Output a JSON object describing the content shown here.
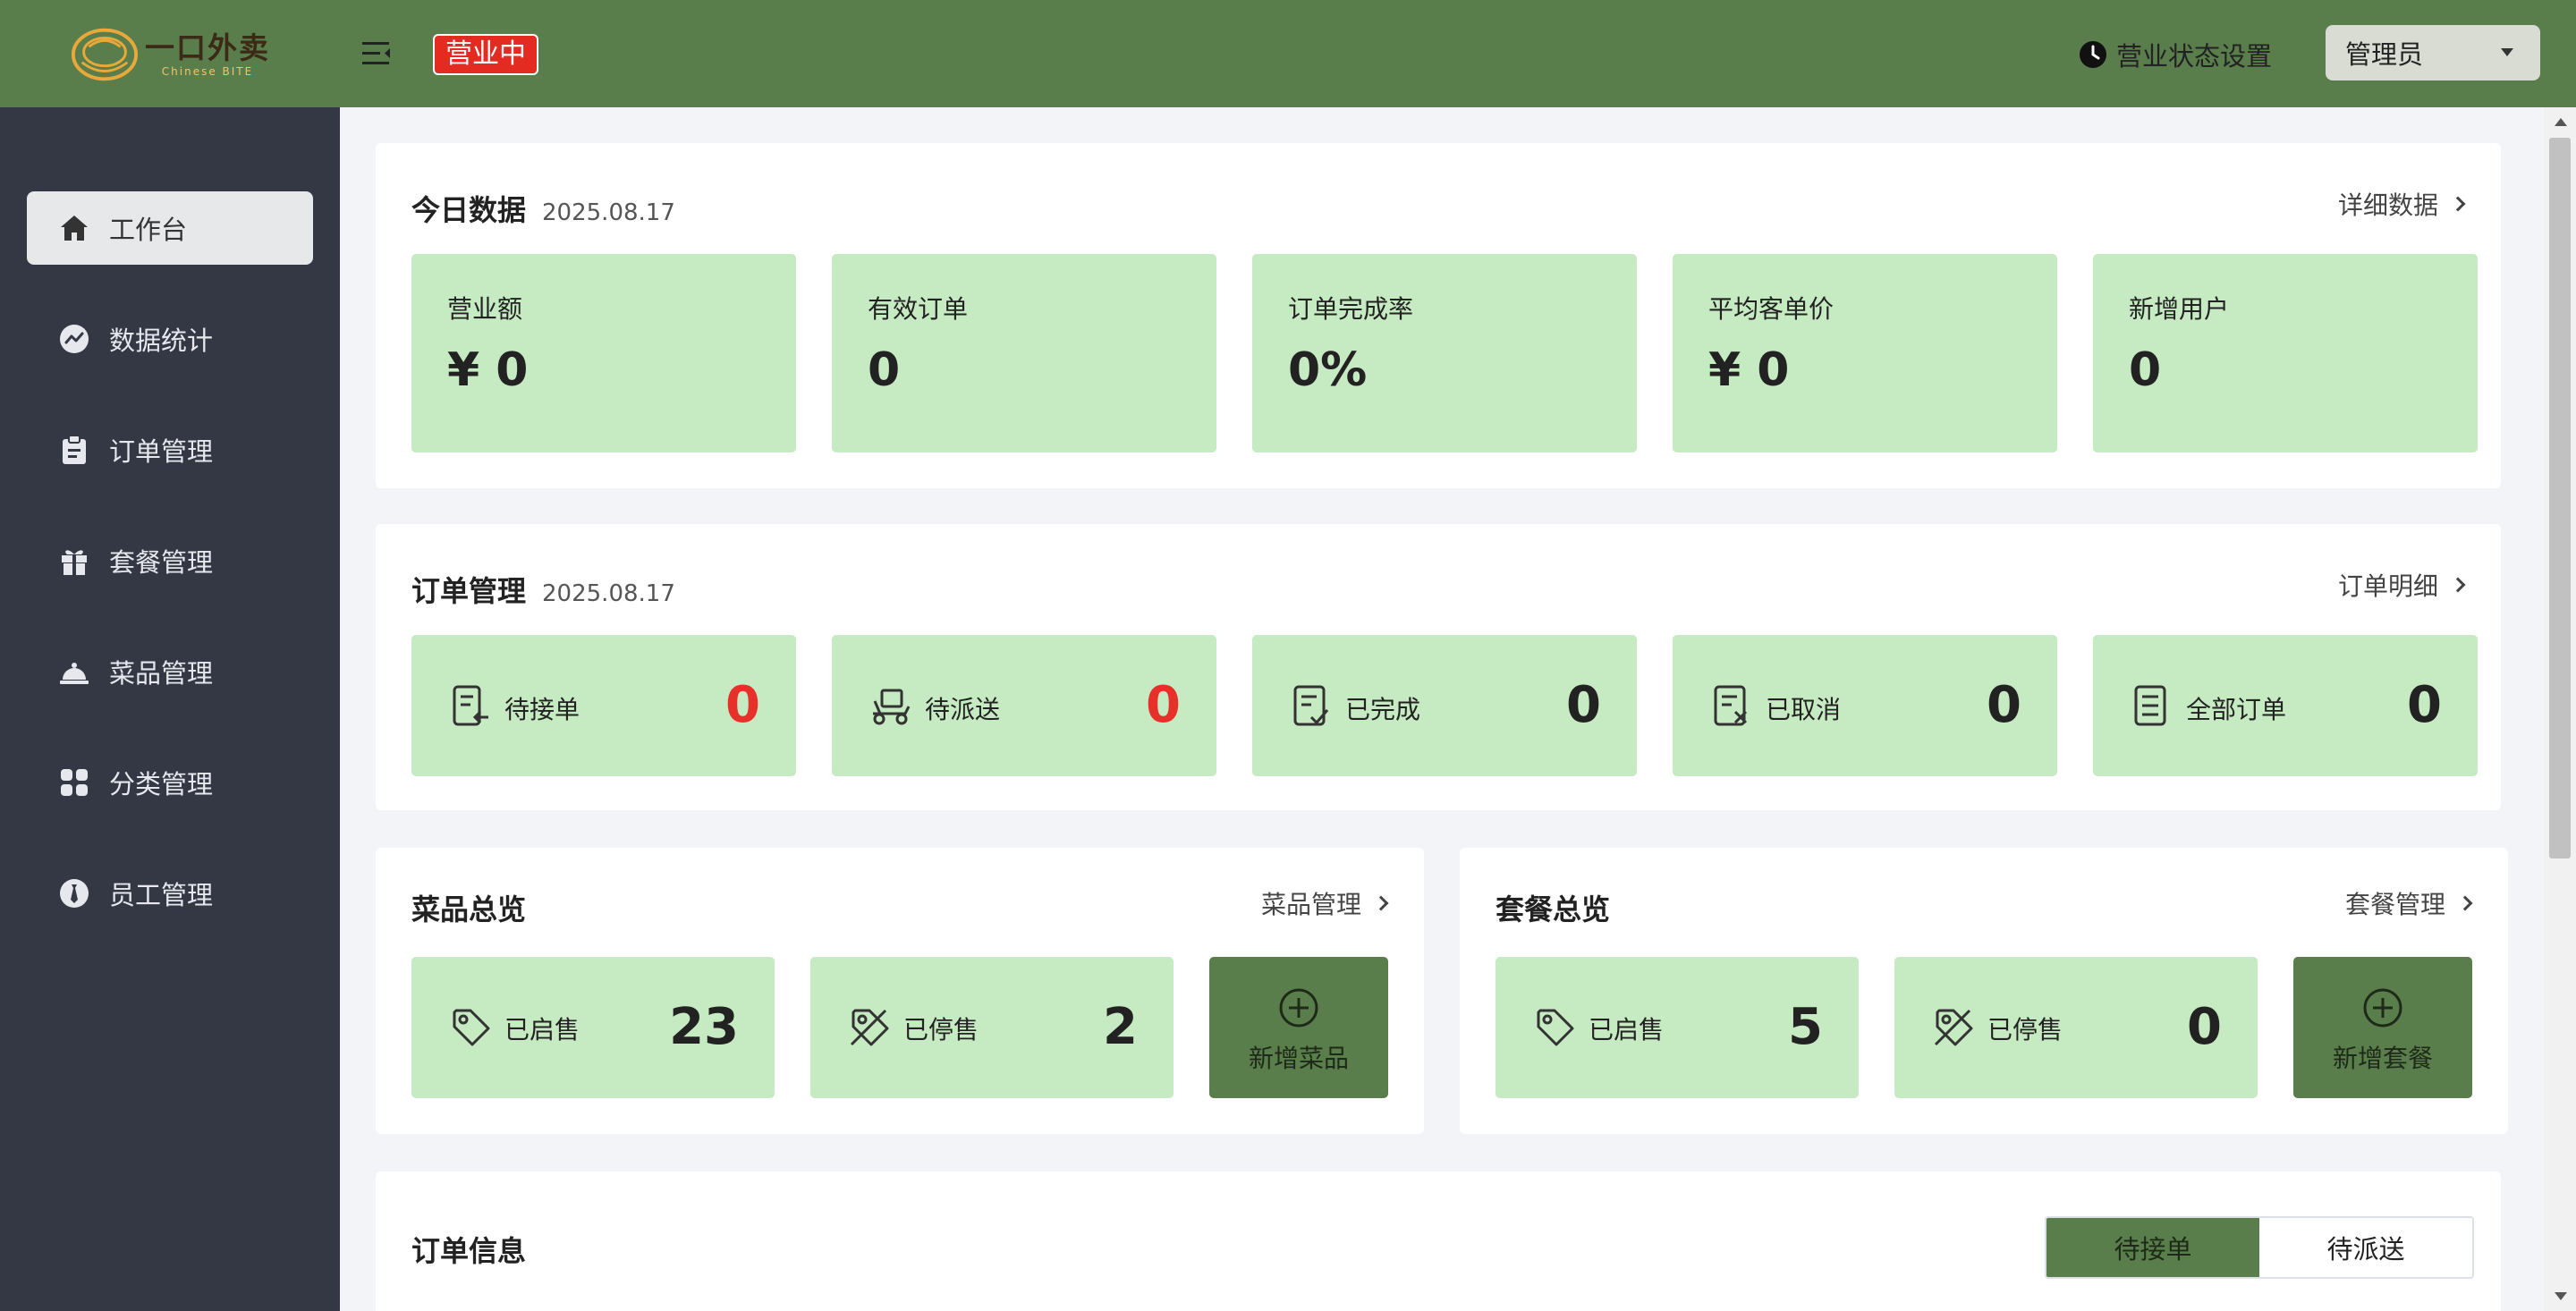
{
  "header": {
    "logo_text": "一口外卖",
    "logo_sub": "Chinese BITE",
    "status_tag": "营业中",
    "biz_setting": "营业状态设置",
    "admin": "管理员",
    "accent_color": "#5a7d4c"
  },
  "sidebar": {
    "items": [
      {
        "label": "工作台",
        "icon": "home-icon",
        "active": true
      },
      {
        "label": "数据统计",
        "icon": "chart-icon"
      },
      {
        "label": "订单管理",
        "icon": "clipboard-icon"
      },
      {
        "label": "套餐管理",
        "icon": "gift-icon"
      },
      {
        "label": "菜品管理",
        "icon": "dish-cover-icon"
      },
      {
        "label": "分类管理",
        "icon": "grid-icon"
      },
      {
        "label": "员工管理",
        "icon": "employee-icon"
      }
    ]
  },
  "today": {
    "title": "今日数据",
    "date": "2025.08.17",
    "link": "详细数据",
    "stats": [
      {
        "label": "营业额",
        "value": "¥ 0"
      },
      {
        "label": "有效订单",
        "value": "0"
      },
      {
        "label": "订单完成率",
        "value": "0%"
      },
      {
        "label": "平均客单价",
        "value": "¥ 0"
      },
      {
        "label": "新增用户",
        "value": "0"
      }
    ]
  },
  "orders": {
    "title": "订单管理",
    "date": "2025.08.17",
    "link": "订单明细",
    "items": [
      {
        "label": "待接单",
        "count": "0",
        "icon": "pending-order-icon"
      },
      {
        "label": "待派送",
        "count": "0",
        "icon": "delivery-icon"
      },
      {
        "label": "已完成",
        "count": "0",
        "icon": "completed-order-icon"
      },
      {
        "label": "已取消",
        "count": "0",
        "icon": "cancelled-order-icon"
      },
      {
        "label": "全部订单",
        "count": "0",
        "icon": "all-orders-icon"
      }
    ]
  },
  "dishes": {
    "title": "菜品总览",
    "link": "菜品管理",
    "on_label": "已启售",
    "on_count": "23",
    "off_label": "已停售",
    "off_count": "2",
    "add_label": "新增菜品"
  },
  "setmeals": {
    "title": "套餐总览",
    "link": "套餐管理",
    "on_label": "已启售",
    "on_count": "5",
    "off_label": "已停售",
    "off_count": "0",
    "add_label": "新增套餐"
  },
  "order_info": {
    "title": "订单信息",
    "tabs": [
      "待接单",
      "待派送"
    ]
  }
}
